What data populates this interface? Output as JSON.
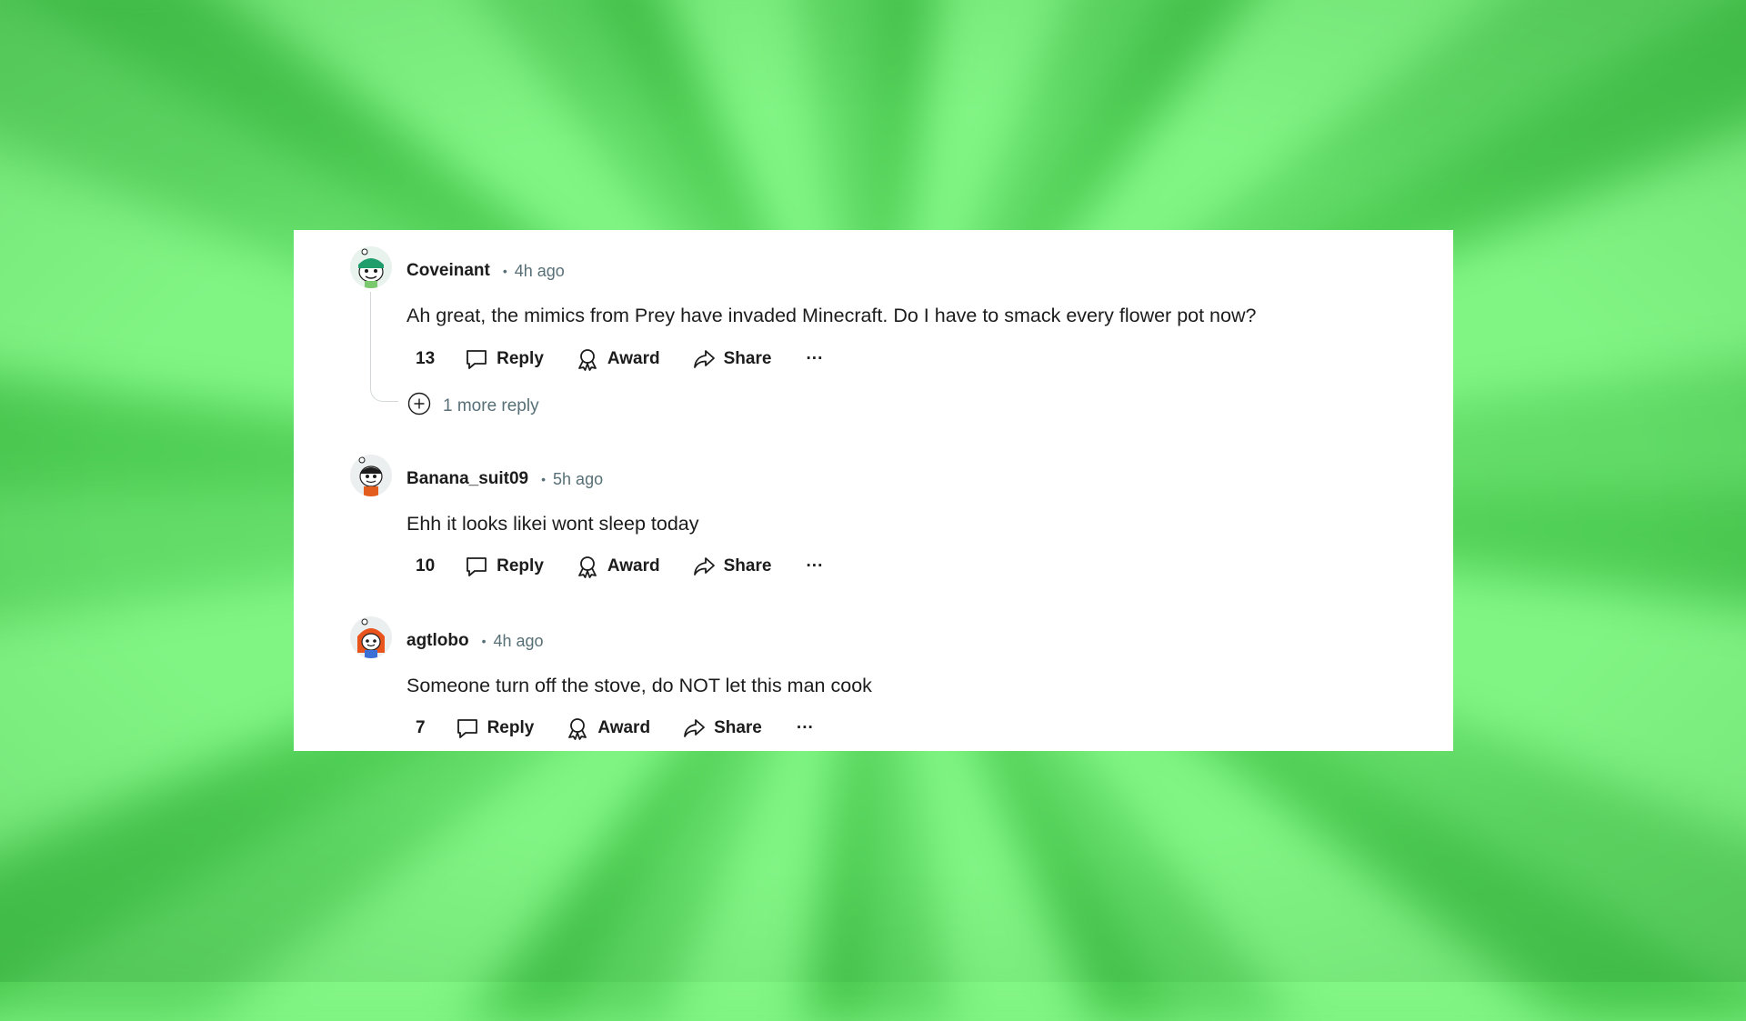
{
  "comments": [
    {
      "username": "Coveinant",
      "separator": "•",
      "time": "4h ago",
      "text": "Ah great, the mimics from Prey have invaded Minecraft. Do I have to smack every flower pot now?",
      "votes": "13",
      "reply_label": "Reply",
      "award_label": "Award",
      "share_label": "Share",
      "more_label": "···",
      "more_replies": "1 more reply"
    },
    {
      "username": "Banana_suit09",
      "separator": "•",
      "time": "5h ago",
      "text": "Ehh it looks likei wont sleep today",
      "votes": "10",
      "reply_label": "Reply",
      "award_label": "Award",
      "share_label": "Share",
      "more_label": "···"
    },
    {
      "username": "agtlobo",
      "separator": "•",
      "time": "4h ago",
      "text": "Someone turn off the stove, do NOT let this man cook",
      "votes": "7",
      "reply_label": "Reply",
      "award_label": "Award",
      "share_label": "Share",
      "more_label": "···"
    }
  ],
  "colors": {
    "background_green": "#7cf37f",
    "panel": "#ffffff",
    "text": "#1c1c1c",
    "muted": "#576f76"
  },
  "icons": [
    "upvote-icon",
    "downvote-icon",
    "comment-icon",
    "award-icon",
    "share-icon",
    "more-icon",
    "expand-plus-icon",
    "avatar-icon"
  ]
}
